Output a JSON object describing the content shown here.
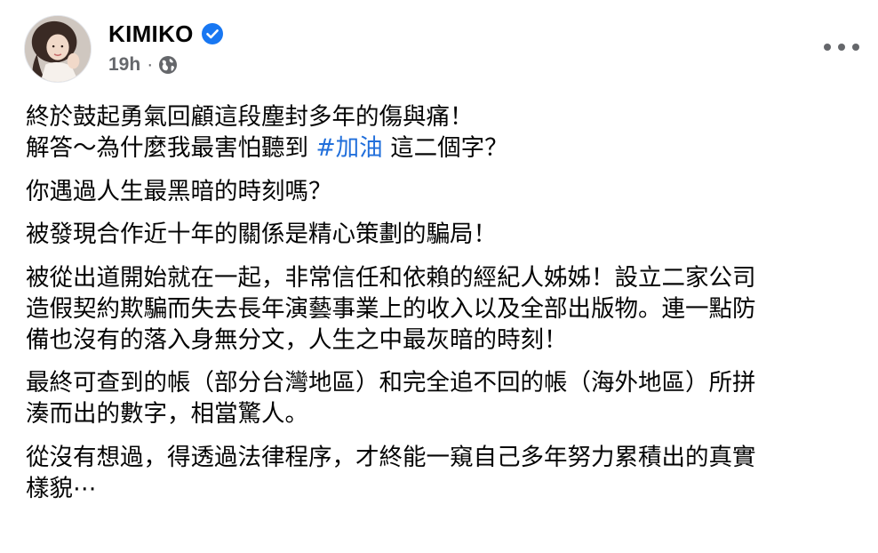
{
  "post": {
    "author": "KIMIKO",
    "verified": true,
    "timestamp": "19h",
    "separator": "·",
    "audience_icon": "globe-icon",
    "more_icon": "more-options-icon",
    "hashtag_color": "#216fdb",
    "body": {
      "p1_line1": "終於鼓起勇氣回顧這段塵封多年的傷與痛！",
      "p1_line2_before": "解答～為什麼我最害怕聽到 ",
      "p1_hashtag": "#加油",
      "p1_line2_after": " 這二個字？",
      "p2": "你遇過人生最黑暗的時刻嗎？",
      "p3": "被發現合作近十年的關係是精心策劃的騙局！",
      "p4_line1": "被從出道開始就在一起，非常信任和依賴的經紀人姊姊！設立二家公司",
      "p4_line2": "造假契約欺騙而失去長年演藝事業上的收入以及全部出版物。連一點防",
      "p4_line3": "備也沒有的落入身無分文，人生之中最灰暗的時刻！",
      "p5_line1": "最終可查到的帳（部分台灣地區）和完全追不回的帳（海外地區）所拼",
      "p5_line2": "湊而出的數字，相當驚人。",
      "p6_line1": "從沒有想過，得透過法律程序，才終能一窺自己多年努力累積出的真實",
      "p6_line2": "樣貌⋯"
    }
  }
}
